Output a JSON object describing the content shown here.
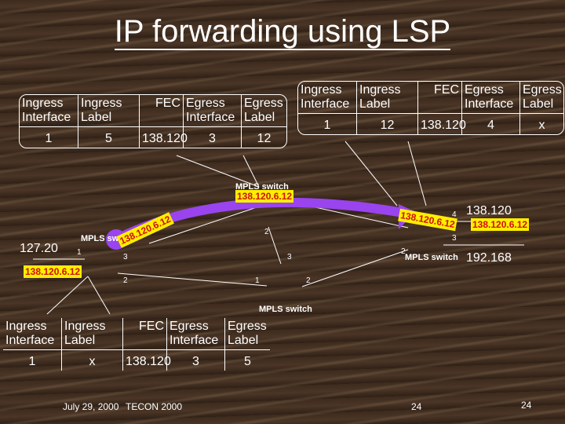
{
  "title": "IP forwarding using LSP",
  "headers": [
    "Ingress Interface",
    "Ingress Label",
    "FEC",
    "Egress Interface",
    "Egress Label"
  ],
  "tables": {
    "top_left": {
      "row": [
        "1",
        "5",
        "138.120",
        "3",
        "12"
      ]
    },
    "top_right": {
      "row": [
        "1",
        "12",
        "138.120",
        "4",
        "x"
      ]
    },
    "bottom": {
      "row": [
        "1",
        "x",
        "138.120",
        "3",
        "5"
      ]
    }
  },
  "diagram": {
    "switch_label": "MPLS switch",
    "switch_label_truncated": "MPLS sw",
    "host_left": "127.20",
    "host_right_top": "138.120",
    "host_right_bottom": "192.168",
    "packet_label": "138.120.6.12",
    "ports": [
      "1",
      "2",
      "3",
      "4"
    ]
  },
  "colors": {
    "lsp": "#9944ee",
    "tag_bg": "#ffee00",
    "tag_text": "#cc1111"
  },
  "footer": {
    "date": "July 29, 2000",
    "event": "TECON 2000",
    "page_center": "24",
    "page_right": "24"
  }
}
